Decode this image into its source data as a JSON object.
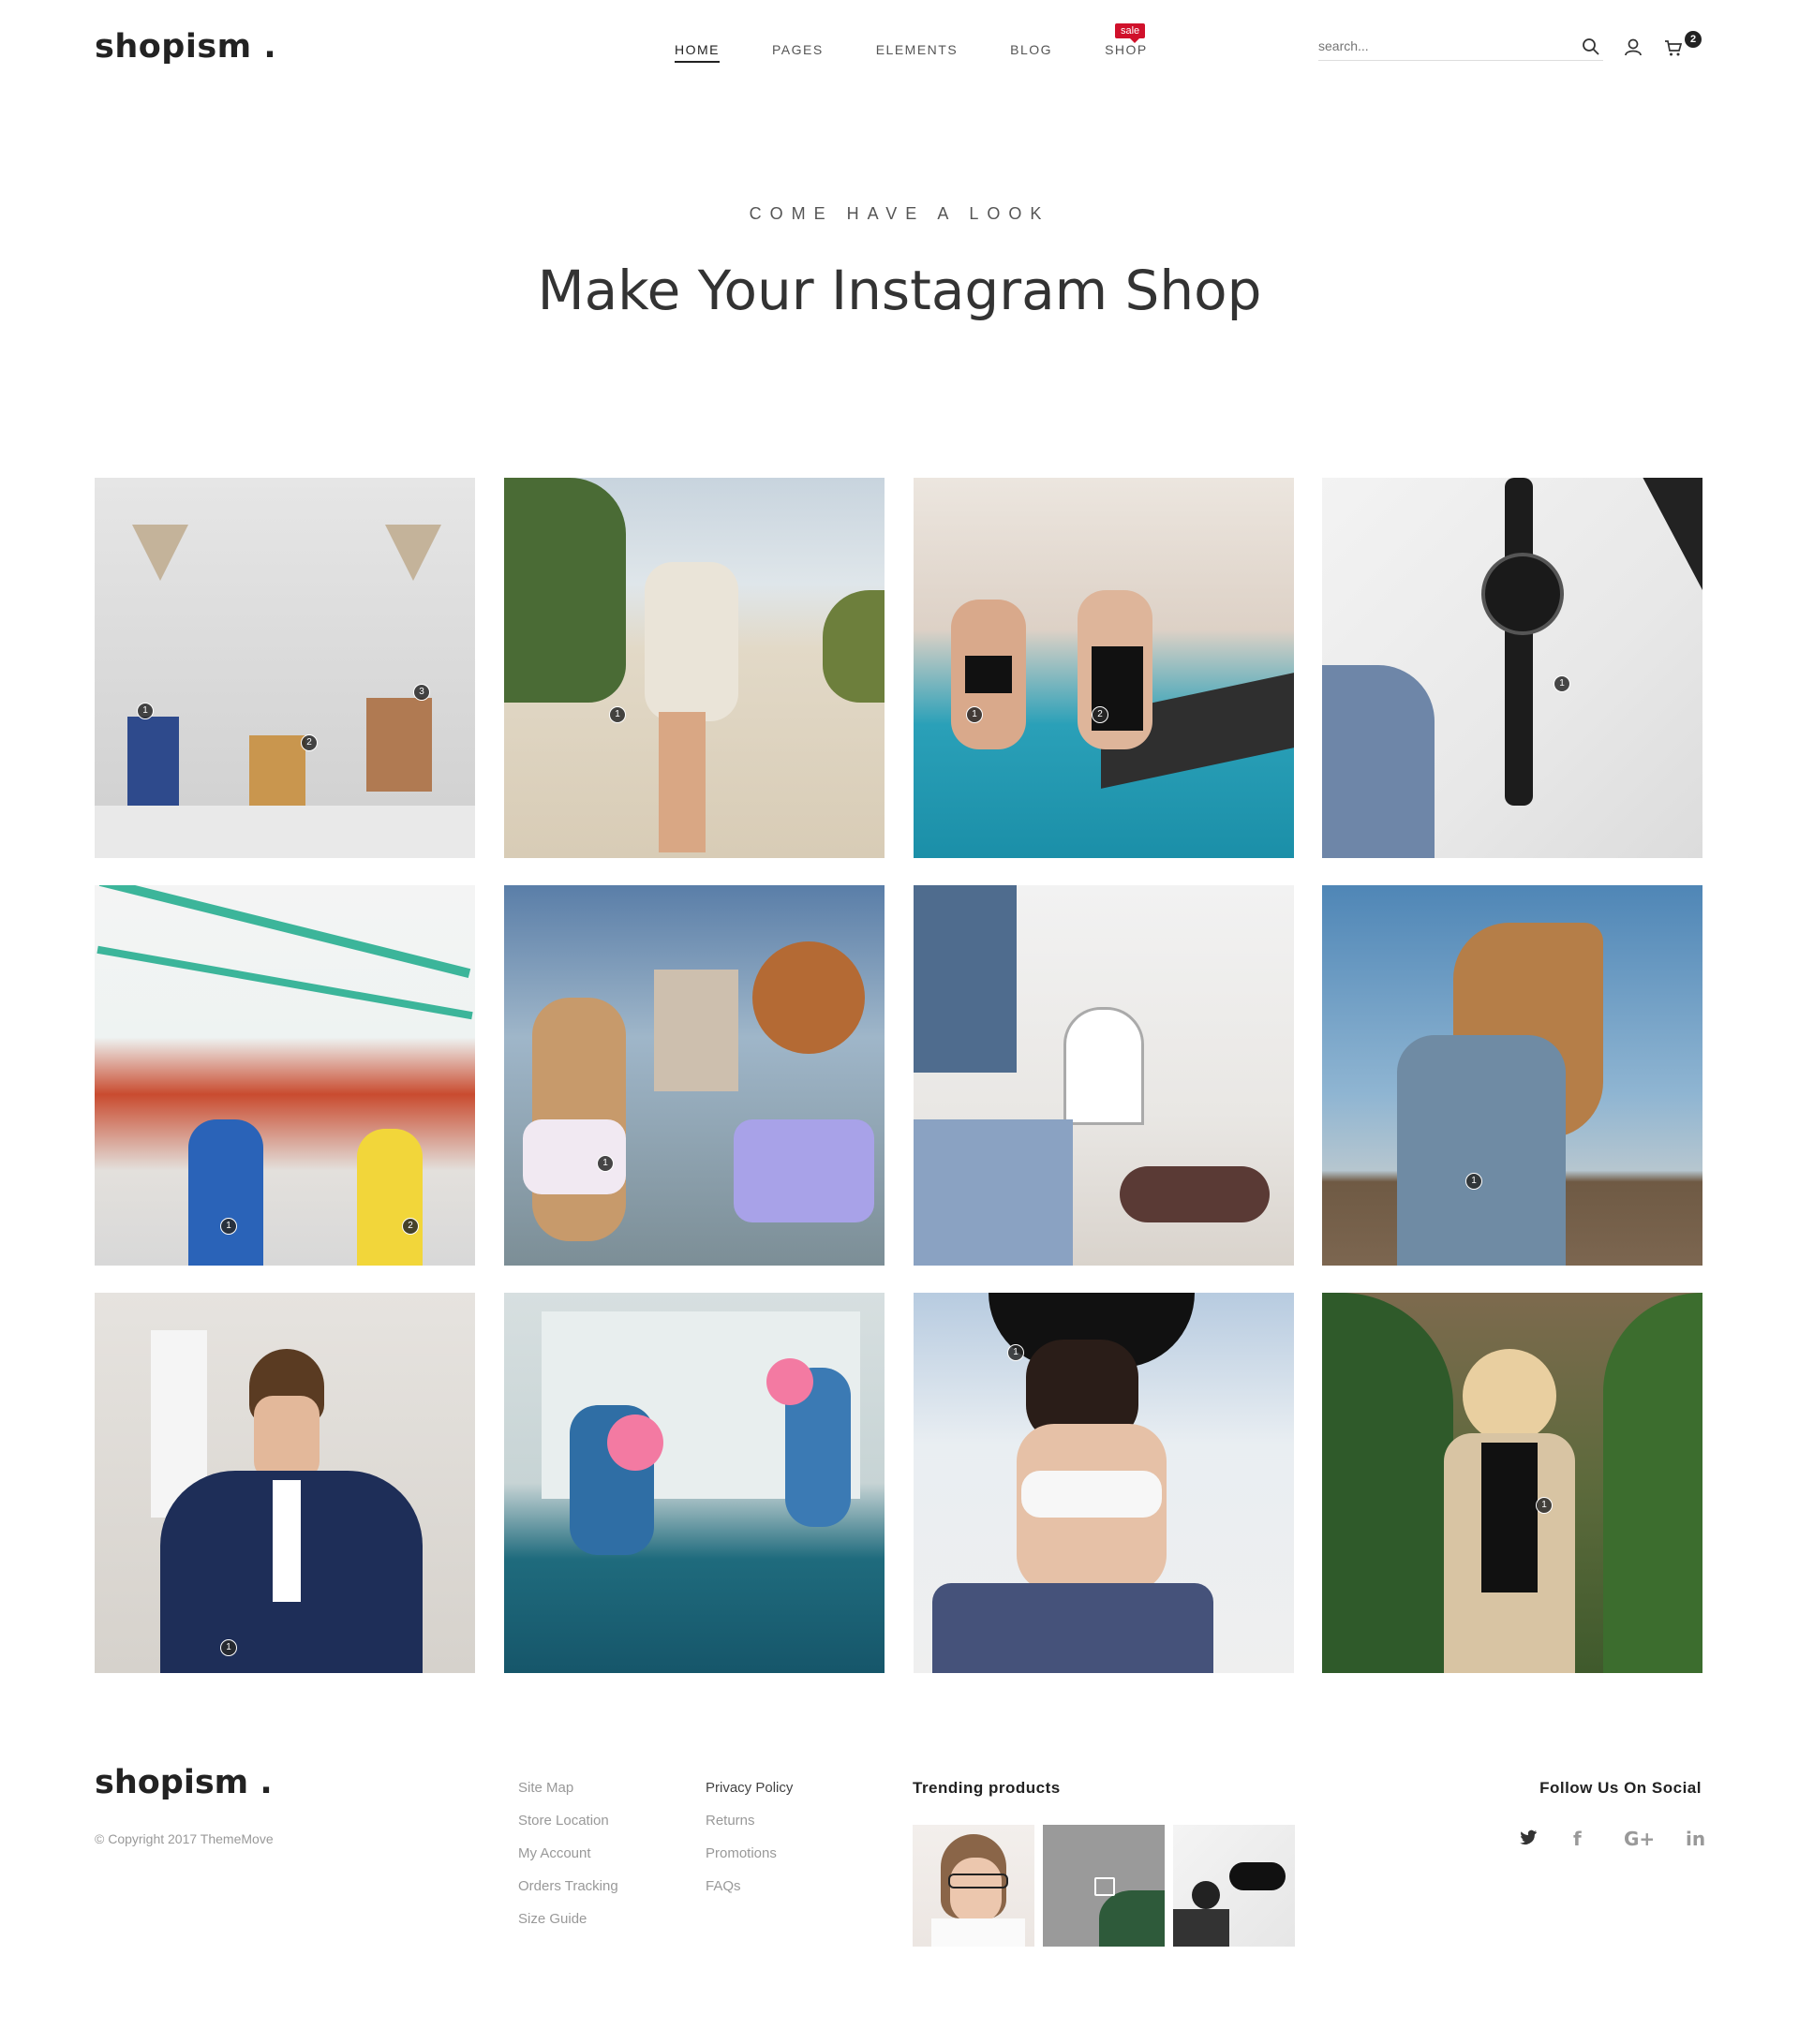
{
  "brand": {
    "logo": "shopism ."
  },
  "nav": {
    "items": [
      {
        "label": "HOME",
        "active": true
      },
      {
        "label": "PAGES"
      },
      {
        "label": "ELEMENTS"
      },
      {
        "label": "BLOG"
      },
      {
        "label": "SHOP"
      }
    ],
    "sale_badge": "sale"
  },
  "search": {
    "placeholder": "search..."
  },
  "cart": {
    "count": "2"
  },
  "hero": {
    "subtitle": "COME HAVE A LOOK",
    "title": "Make Your Instagram Shop"
  },
  "gallery": {
    "tiles": [
      {
        "subject": "bags-on-brick-wall",
        "pins": [
          "1",
          "2",
          "3"
        ]
      },
      {
        "subject": "woman-walking-beach",
        "pins": [
          "1"
        ]
      },
      {
        "subject": "women-by-pool",
        "pins": [
          "1",
          "2"
        ]
      },
      {
        "subject": "black-watch-flatlay",
        "pins": [
          "1"
        ]
      },
      {
        "subject": "girls-at-fair",
        "pins": [
          "1",
          "2"
        ]
      },
      {
        "subject": "curly-hair-women",
        "pins": [
          "1"
        ]
      },
      {
        "subject": "boutique-interior",
        "pins": []
      },
      {
        "subject": "girl-in-wind",
        "pins": [
          "1"
        ]
      },
      {
        "subject": "man-in-plaid-suit",
        "pins": [
          "1"
        ]
      },
      {
        "subject": "girls-cotton-candy",
        "pins": []
      },
      {
        "subject": "woman-in-hat",
        "pins": [
          "1"
        ]
      },
      {
        "subject": "woman-in-swimsuit",
        "pins": [
          "1"
        ]
      }
    ]
  },
  "footer": {
    "logo": "shopism .",
    "copyright": "© Copyright 2017 ThemeMove",
    "links_col1": [
      "Site Map",
      "Store Location",
      "My Account",
      "Orders Tracking",
      "Size Guide"
    ],
    "links_col2": [
      "Privacy Policy",
      "Returns",
      "Promotions",
      "FAQs"
    ],
    "trending_title": "Trending products",
    "trending_products": [
      "woman-glasses",
      "handbag-plant",
      "sunglasses-flatlay"
    ],
    "follow_title": "Follow Us On Social",
    "social": [
      {
        "icon": "twitter-icon",
        "glyph": "𝕥"
      },
      {
        "icon": "facebook-icon",
        "glyph": "f"
      },
      {
        "icon": "google-plus-icon",
        "glyph": "G+"
      },
      {
        "icon": "linkedin-icon",
        "glyph": "in"
      }
    ]
  },
  "colors": {
    "accent_sale": "#d0112b",
    "text_dark": "#222222",
    "text_muted": "#999999"
  }
}
